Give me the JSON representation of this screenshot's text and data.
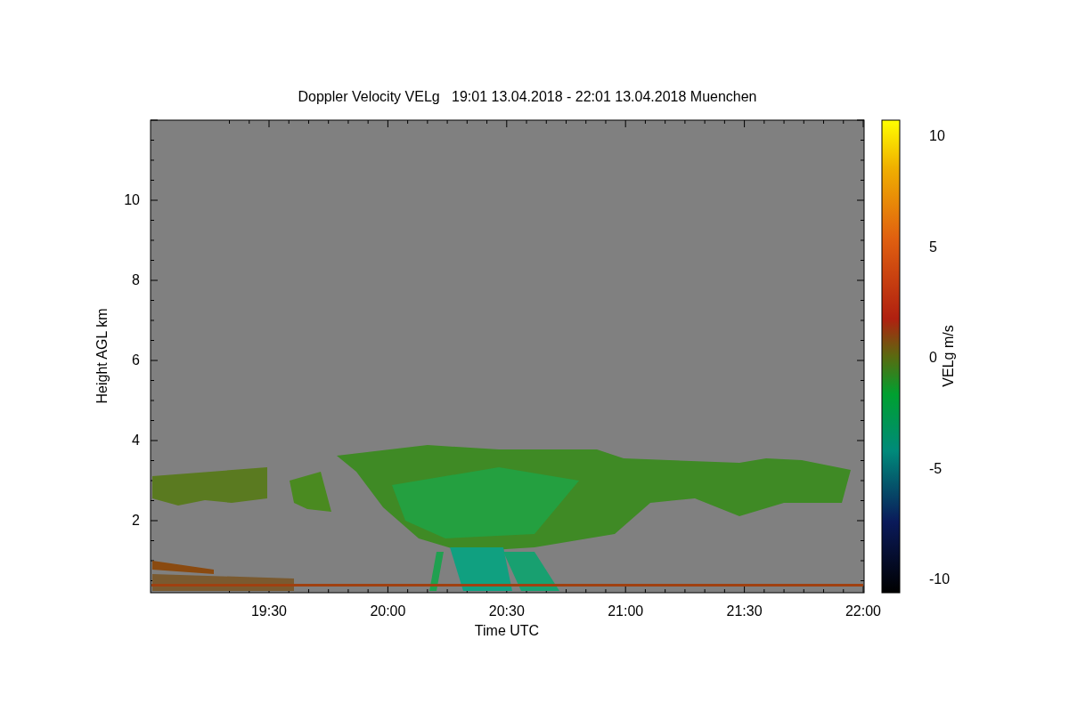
{
  "chart": {
    "title": "Doppler Velocity VELg   19:01 13.04.2018 - 22:01 13.04.2018 Muenchen",
    "xlabel": "Time UTC",
    "ylabel": "Height AGL km",
    "xticks": [
      "19:30",
      "20:00",
      "20:30",
      "21:00",
      "21:30",
      "22:00"
    ],
    "yticks": [
      "10",
      "8",
      "6",
      "4",
      "2"
    ]
  },
  "colorbar": {
    "label": "VELg m/s",
    "ticks": [
      "10",
      "5",
      "0",
      "-5",
      "-10"
    ]
  }
}
